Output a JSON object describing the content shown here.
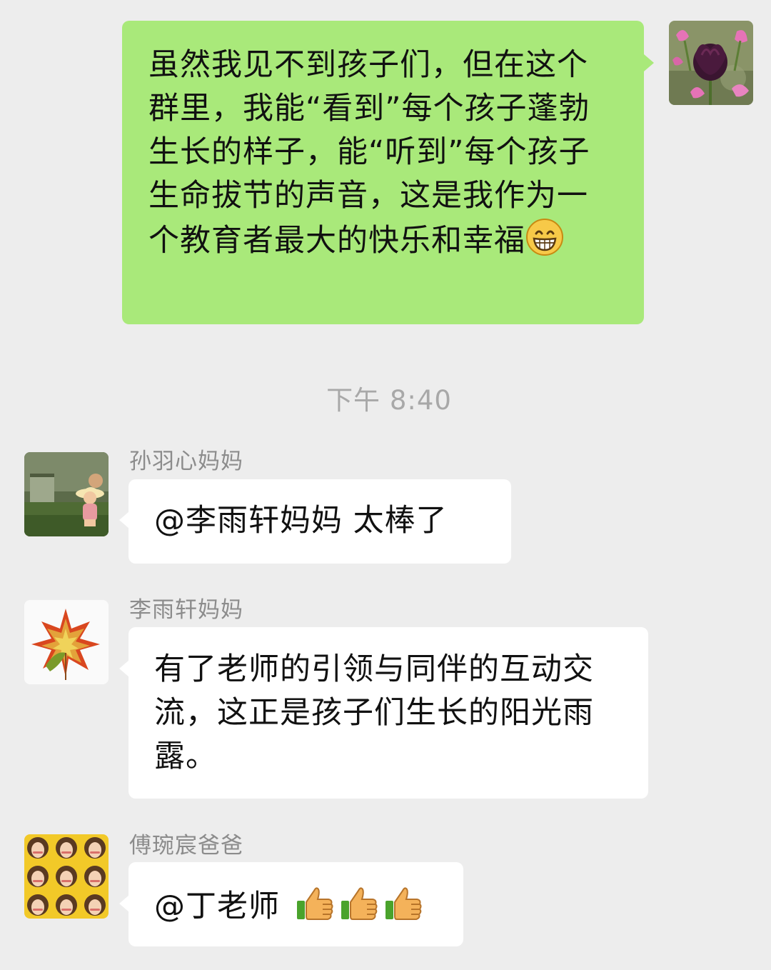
{
  "messages": [
    {
      "id": "msg-1",
      "direction": "sent",
      "avatar": "tulip-flower-avatar",
      "text": "虽然我见不到孩子们，但在这个群里，我能“看到”每个孩子蓬勃生长的样子，能“听到”每个孩子生命拔节的声音，这是我作为一个教育者最大的快乐和幸福",
      "emoji": "grinning-face-emoji"
    },
    {
      "id": "time-1",
      "type": "timestamp",
      "text": "下午 8:40"
    },
    {
      "id": "msg-2",
      "direction": "received",
      "sender": "孙羽心妈妈",
      "avatar": "cartoon-girl-avatar",
      "text": "@李雨轩妈妈 太棒了"
    },
    {
      "id": "msg-3",
      "direction": "received",
      "sender": "李雨轩妈妈",
      "avatar": "maple-leaves-avatar",
      "text": "有了老师的引领与同伴的互动交流，这正是孩子们生长的阳光雨露。"
    },
    {
      "id": "msg-4",
      "direction": "received",
      "sender": "傅琬宸爸爸",
      "avatar": "photo-grid-avatar",
      "text": "@丁老师",
      "emoji": [
        "thumbs-up-emoji",
        "thumbs-up-emoji",
        "thumbs-up-emoji"
      ]
    }
  ],
  "colors": {
    "background": "#ededed",
    "sent_bubble": "#a9e97a",
    "received_bubble": "#ffffff",
    "name_text": "#8c8c8c",
    "timestamp_text": "#a8a8a8"
  }
}
